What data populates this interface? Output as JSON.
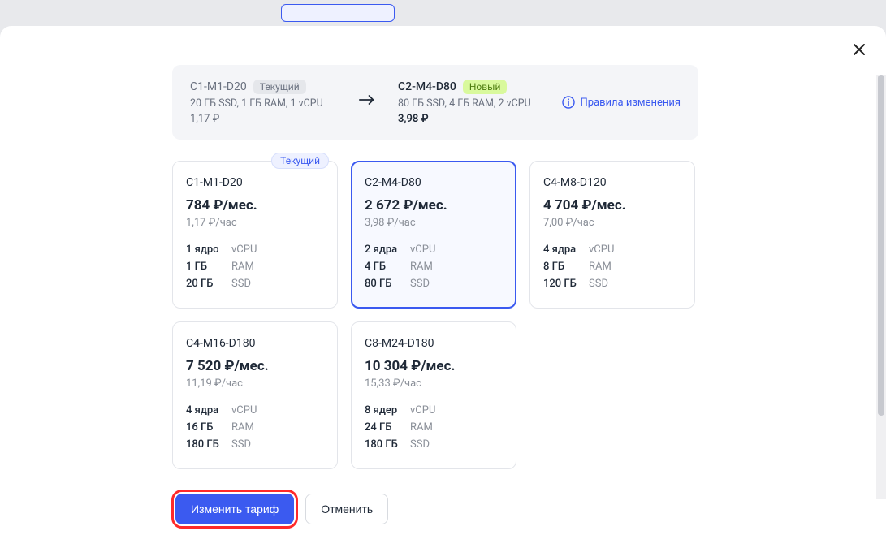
{
  "summary": {
    "current": {
      "name": "C1-M1-D20",
      "badge": "Текущий",
      "specs": "20 ГБ SSD, 1 ГБ RAM, 1 vCPU",
      "price": "1,17 ₽"
    },
    "new": {
      "name": "C2-M4-D80",
      "badge": "Новый",
      "specs": "80 ГБ SSD, 4 ГБ RAM, 2 vCPU",
      "price": "3,98 ₽"
    },
    "rules_label": "Правила изменения"
  },
  "plans": [
    {
      "name": "C1-M1-D20",
      "month": "784 ₽/мес.",
      "hour": "1,17 ₽/час",
      "cores": "1 ядро",
      "ram": "1 ГБ",
      "ssd": "20 ГБ",
      "current": true,
      "selected": false
    },
    {
      "name": "C2-M4-D80",
      "month": "2 672 ₽/мес.",
      "hour": "3,98 ₽/час",
      "cores": "2 ядра",
      "ram": "4 ГБ",
      "ssd": "80 ГБ",
      "current": false,
      "selected": true
    },
    {
      "name": "C4-M8-D120",
      "month": "4 704 ₽/мес.",
      "hour": "7,00 ₽/час",
      "cores": "4 ядра",
      "ram": "8 ГБ",
      "ssd": "120 ГБ",
      "current": false,
      "selected": false
    },
    {
      "name": "C4-M16-D180",
      "month": "7 520 ₽/мес.",
      "hour": "11,19 ₽/час",
      "cores": "4 ядра",
      "ram": "16 ГБ",
      "ssd": "180 ГБ",
      "current": false,
      "selected": false
    },
    {
      "name": "C8-M24-D180",
      "month": "10 304 ₽/мес.",
      "hour": "15,33 ₽/час",
      "cores": "8 ядер",
      "ram": "24 ГБ",
      "ssd": "180 ГБ",
      "current": false,
      "selected": false
    }
  ],
  "spec_labels": {
    "cores": "vCPU",
    "ram": "RAM",
    "ssd": "SSD"
  },
  "current_chip": "Текущий",
  "footer": {
    "primary": "Изменить тариф",
    "secondary": "Отменить"
  }
}
